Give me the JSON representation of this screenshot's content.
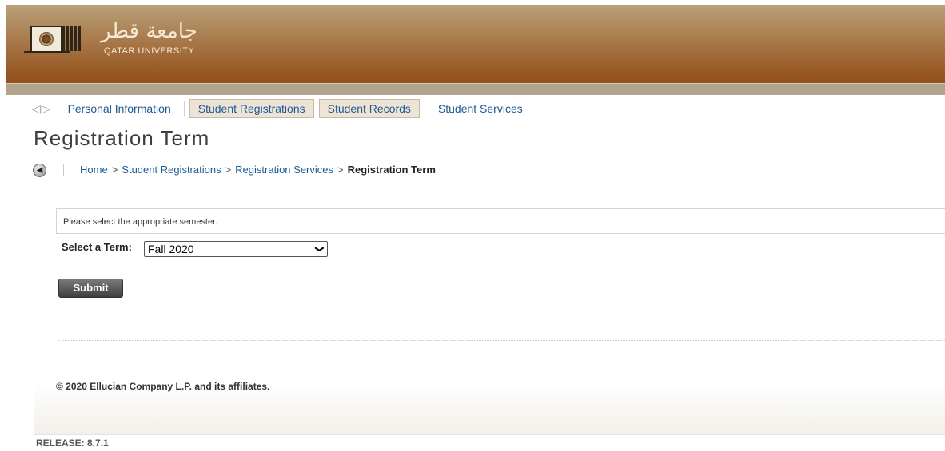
{
  "header": {
    "logo_arabic": "جامعة قطر",
    "logo_english": "QATAR UNIVERSITY"
  },
  "nav": {
    "tabs": [
      {
        "label": "Personal Information",
        "active": false
      },
      {
        "label": "Student Registrations",
        "active": true
      },
      {
        "label": "Student Records",
        "active": true
      },
      {
        "label": "Student Services",
        "active": false
      }
    ]
  },
  "page": {
    "title": "Registration Term"
  },
  "breadcrumb": {
    "items": [
      "Home",
      "Student Registrations",
      "Registration Services"
    ],
    "separator": ">",
    "current": "Registration Term"
  },
  "form": {
    "info_text": "Please select the appropriate semester.",
    "term_label": "Select a Term:",
    "term_selected": "Fall 2020",
    "submit_label": "Submit"
  },
  "footer": {
    "copyright": "© 2020 Ellucian Company L.P. and its affiliates.",
    "release": "RELEASE: 8.7.1"
  },
  "colors": {
    "banner": "#96541e",
    "link": "#1e5a92",
    "active_tab_bg": "#eee4d6"
  },
  "icons": {
    "prev_arrow": "triangle-left-icon",
    "next_arrow": "triangle-right-icon",
    "back": "back-arrow-icon",
    "select_chevron": "chevron-down-icon",
    "logo": "university-logo"
  }
}
